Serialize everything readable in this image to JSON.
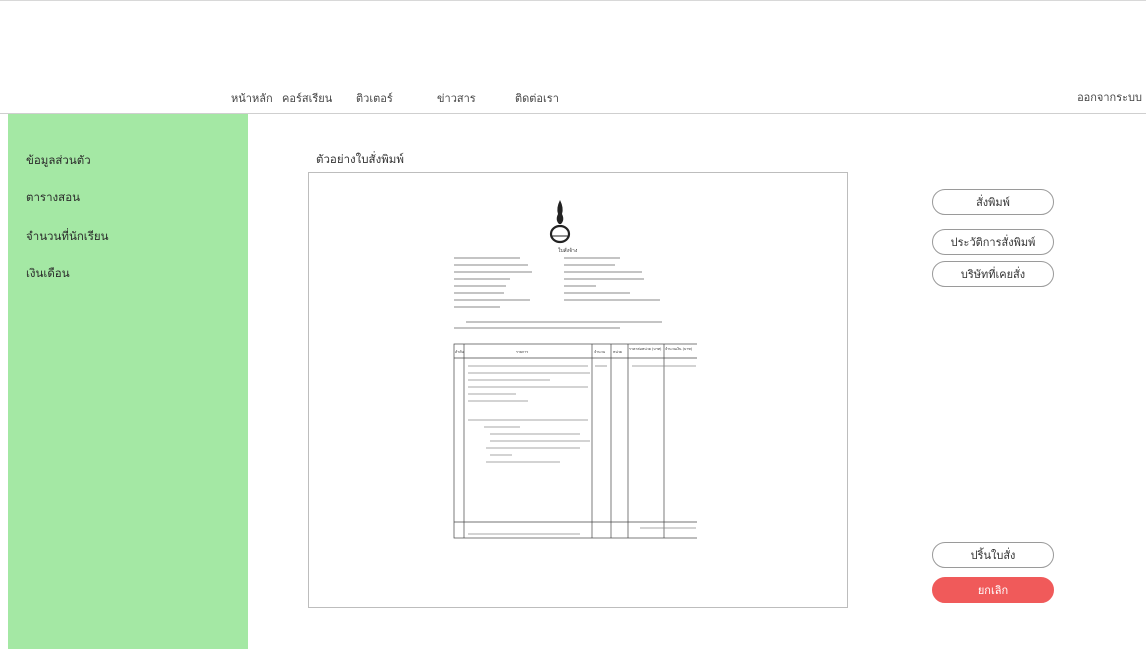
{
  "nav": {
    "items": [
      {
        "label": "หน้าหลัก"
      },
      {
        "label": "คอร์สเรียน"
      },
      {
        "label": "ติวเตอร์"
      },
      {
        "label": "ข่าวสาร"
      },
      {
        "label": "ติดต่อเรา"
      }
    ],
    "logout_label": "ออกจากระบบ"
  },
  "sidebar": {
    "items": [
      {
        "label": "ข้อมูลส่วนตัว"
      },
      {
        "label": "ตารางสอน"
      },
      {
        "label": "จำนวนที่นักเรียน"
      },
      {
        "label": "เงินเดือน"
      }
    ]
  },
  "main": {
    "preview_title": "ตัวอย่างใบสั่งพิมพ์",
    "document": {
      "heading": "ใบสั่งจ้าง",
      "table_headers": [
        "ลำดับ",
        "รายการ",
        "จำนวน",
        "หน่วย",
        "ราคาต่อหน่วย (บาท)",
        "จำนวนเงิน (บาท)"
      ]
    }
  },
  "actions": {
    "print": "สั่งพิมพ์",
    "history": "ประวัติการสั่งพิมพ์",
    "companies": "บริษัทที่เคยสั่ง",
    "print_slip": "ปริ้นใบสั่ง",
    "cancel": "ยกเลิก"
  },
  "colors": {
    "sidebar": "#a4e8a4",
    "cancel": "#f05a5a"
  }
}
